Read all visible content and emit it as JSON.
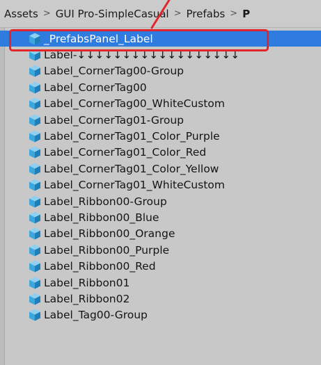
{
  "breadcrumb": {
    "items": [
      "Assets",
      "GUI Pro-SimpleCasual",
      "Prefabs",
      "P"
    ],
    "separator": ">"
  },
  "colors": {
    "selection": "#2f7ce0",
    "annotation": "#e3242b",
    "prefab_icon": "#3ba7dc"
  },
  "icon": "prefab-cube-icon",
  "list": {
    "items": [
      {
        "label": "_PrefabsPanel_Label",
        "selected": true
      },
      {
        "label": "Label-↓↓↓↓↓↓↓↓↓↓↓↓↓↓↓↓↓↓",
        "selected": false
      },
      {
        "label": "Label_CornerTag00-Group",
        "selected": false
      },
      {
        "label": "Label_CornerTag00",
        "selected": false
      },
      {
        "label": "Label_CornerTag00_WhiteCustom",
        "selected": false
      },
      {
        "label": "Label_CornerTag01-Group",
        "selected": false
      },
      {
        "label": "Label_CornerTag01_Color_Purple",
        "selected": false
      },
      {
        "label": "Label_CornerTag01_Color_Red",
        "selected": false
      },
      {
        "label": "Label_CornerTag01_Color_Yellow",
        "selected": false
      },
      {
        "label": "Label_CornerTag01_WhiteCustom",
        "selected": false
      },
      {
        "label": "Label_Ribbon00-Group",
        "selected": false
      },
      {
        "label": "Label_Ribbon00_Blue",
        "selected": false
      },
      {
        "label": "Label_Ribbon00_Orange",
        "selected": false
      },
      {
        "label": "Label_Ribbon00_Purple",
        "selected": false
      },
      {
        "label": "Label_Ribbon00_Red",
        "selected": false
      },
      {
        "label": "Label_Ribbon01",
        "selected": false
      },
      {
        "label": "Label_Ribbon02",
        "selected": false
      },
      {
        "label": "Label_Tag00-Group",
        "selected": false
      }
    ]
  }
}
